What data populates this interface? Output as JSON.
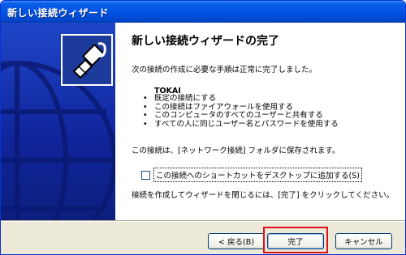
{
  "window": {
    "title": "新しい接続ウィザード"
  },
  "content": {
    "heading": "新しい接続ウィザードの完了",
    "intro": "次の接続の作成に必要な手順は正常に完了しました。",
    "connection_name": "TOKAI",
    "bullets": [
      "既定の接続にする",
      "この接続はファイアウォールを使用する",
      "このコンピュータのすべてのユーザーと共有する",
      "すべての人に同じユーザー名とパスワードを使用する"
    ],
    "saved_note": "この接続は、[ネットワーク接続] フォルダに保存されます。",
    "shortcut_checkbox": {
      "label": "この接続へのショートカットをデスクトップに追加する(S)",
      "checked": false
    },
    "finish_note": "接続を作成してウィザードを閉じるには、[完了] をクリックしてください。"
  },
  "buttons": {
    "back": "< 戻る(B)",
    "finish": "完了",
    "cancel": "キャンセル"
  },
  "colors": {
    "title_bar": "#0054e3",
    "side_panel": "#10249a",
    "highlight": "#e0101a"
  },
  "icons": {
    "wizard_logo": "network-plug-icon",
    "side_art": "globe-graphic"
  }
}
